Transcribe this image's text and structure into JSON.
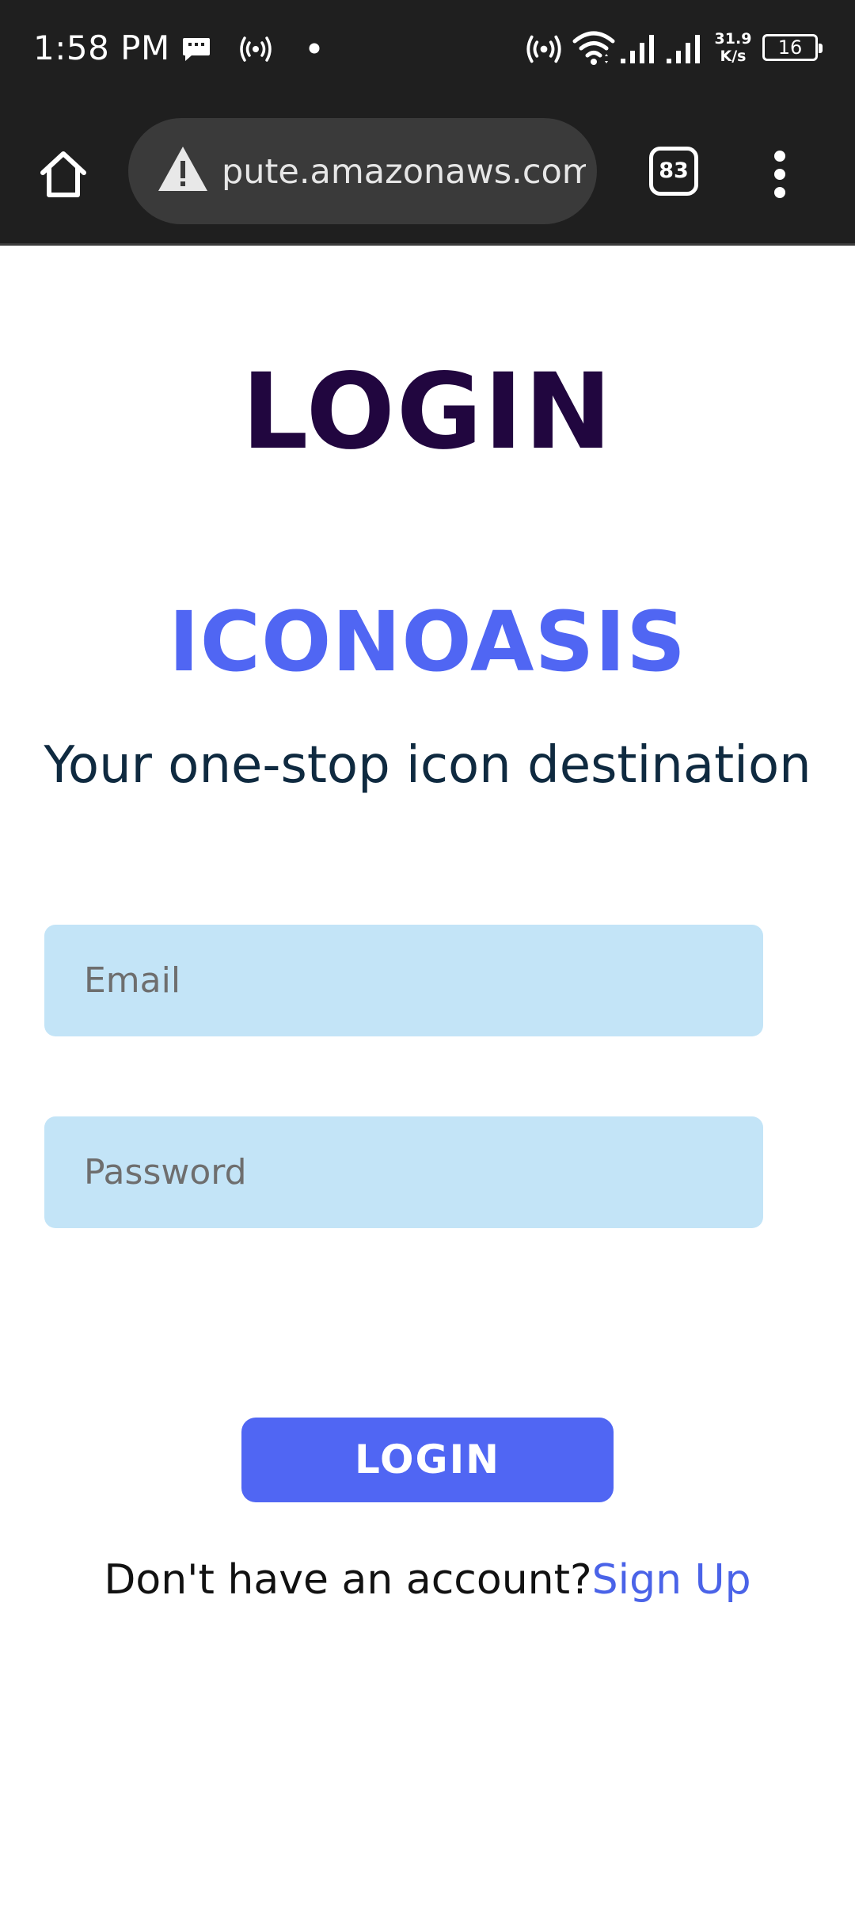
{
  "status_bar": {
    "time": "1:58 PM",
    "speed_value": "31.9",
    "speed_unit": "K/s",
    "battery": "16",
    "icons": [
      "message-icon",
      "hotspot-icon",
      "notification-dot-icon",
      "hotspot-icon",
      "wifi-icon",
      "signal-icon",
      "signal-icon",
      "battery-icon"
    ]
  },
  "browser": {
    "url": "pute.amazonaws.com",
    "tab_count": "83",
    "icons": [
      "home-icon",
      "warning-icon",
      "tab-switcher-icon",
      "more-vert-icon"
    ]
  },
  "page": {
    "heading": "LOGIN",
    "brand": "ICONOASIS",
    "tagline": "Your one-stop icon destination",
    "email_placeholder": "Email",
    "password_placeholder": "Password",
    "login_button": "LOGIN",
    "signup_prompt": "Don't have an account?",
    "signup_link": "Sign Up"
  },
  "colors": {
    "heading": "#21063f",
    "brand": "#5066f3",
    "input_bg": "#c3e4f7",
    "button_bg": "#5066f3",
    "link": "#4a63e8"
  }
}
